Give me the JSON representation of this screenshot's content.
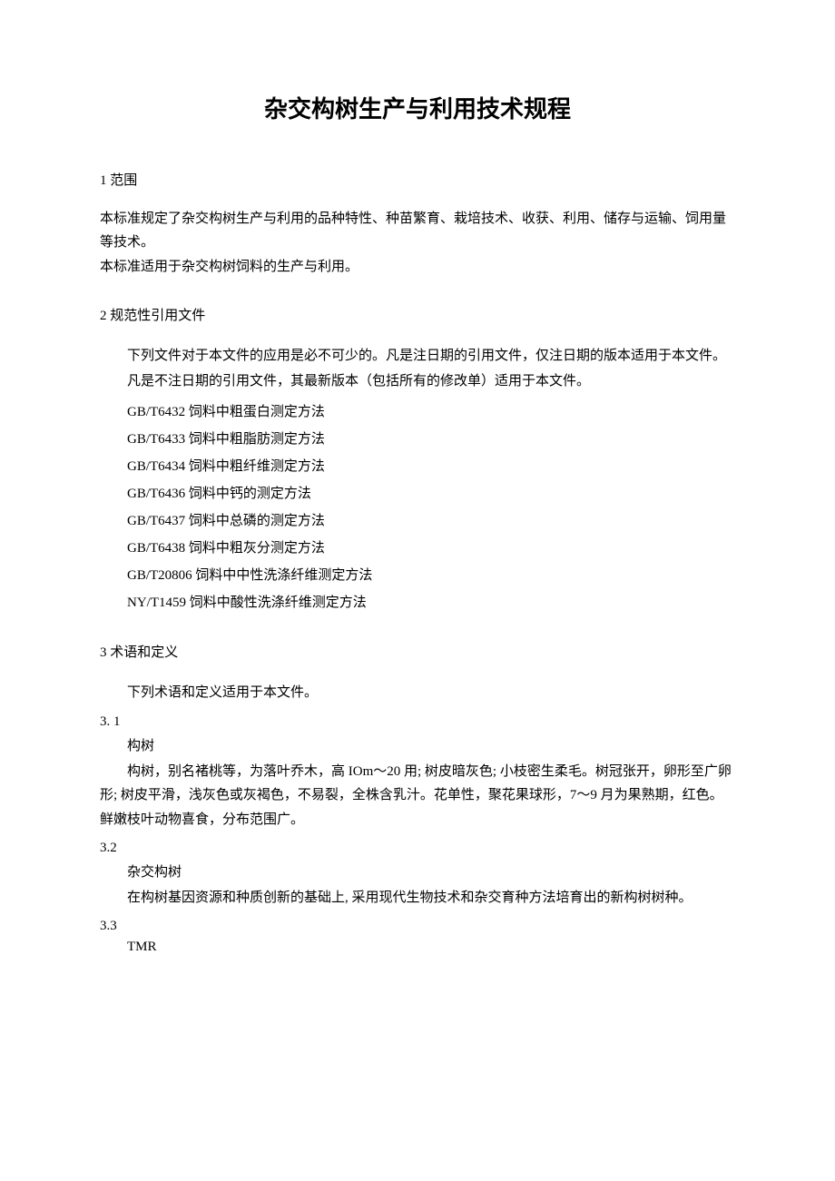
{
  "title": "杂交构树生产与利用技术规程",
  "s1": {
    "heading": "1 范围",
    "p1": "本标准规定了杂交构树生产与利用的品种特性、种苗繁育、栽培技术、收获、利用、储存与运输、饲用量等技术。",
    "p2": "本标准适用于杂交构树饲料的生产与利用。"
  },
  "s2": {
    "heading": "2 规范性引用文件",
    "p1": "下列文件对于本文件的应用是必不可少的。凡是注日期的引用文件，仅注日期的版本适用于本文件。",
    "p2": "凡是不注日期的引用文件，其最新版本（包括所有的修改单）适用于本文件。",
    "refs": [
      "GB/T6432 饲料中粗蛋白测定方法",
      "GB/T6433 饲料中粗脂肪测定方法",
      "GB/T6434 饲料中粗纤维测定方法",
      "GB/T6436 饲料中钙的测定方法",
      "GB/T6437 饲料中总磷的测定方法",
      "GB/T6438 饲料中粗灰分测定方法",
      "GB/T20806 饲料中中性洗涤纤维测定方法",
      "NY/T1459 饲料中酸性洗涤纤维测定方法"
    ]
  },
  "s3": {
    "heading": "3 术语和定义",
    "intro": "下列术语和定义适用于本文件。",
    "t1": {
      "num": "3.   1",
      "name": "构树",
      "body": "构树，别名褚桃等，为落叶乔木，高 IOm～20 用; 树皮暗灰色; 小枝密生柔毛。树冠张开，卵形至广卵形; 树皮平滑，浅灰色或灰褐色，不易裂，全株含乳汁。花单性，聚花果球形，7～9 月为果熟期，红色。鲜嫩枝叶动物喜食，分布范围广。"
    },
    "t2": {
      "num": "3.2",
      "name": "杂交构树",
      "body": "在构树基因资源和种质创新的基础上, 采用现代生物技术和杂交育种方法培育出的新构树树种。"
    },
    "t3": {
      "num": "3.3",
      "name": "TMR"
    }
  }
}
